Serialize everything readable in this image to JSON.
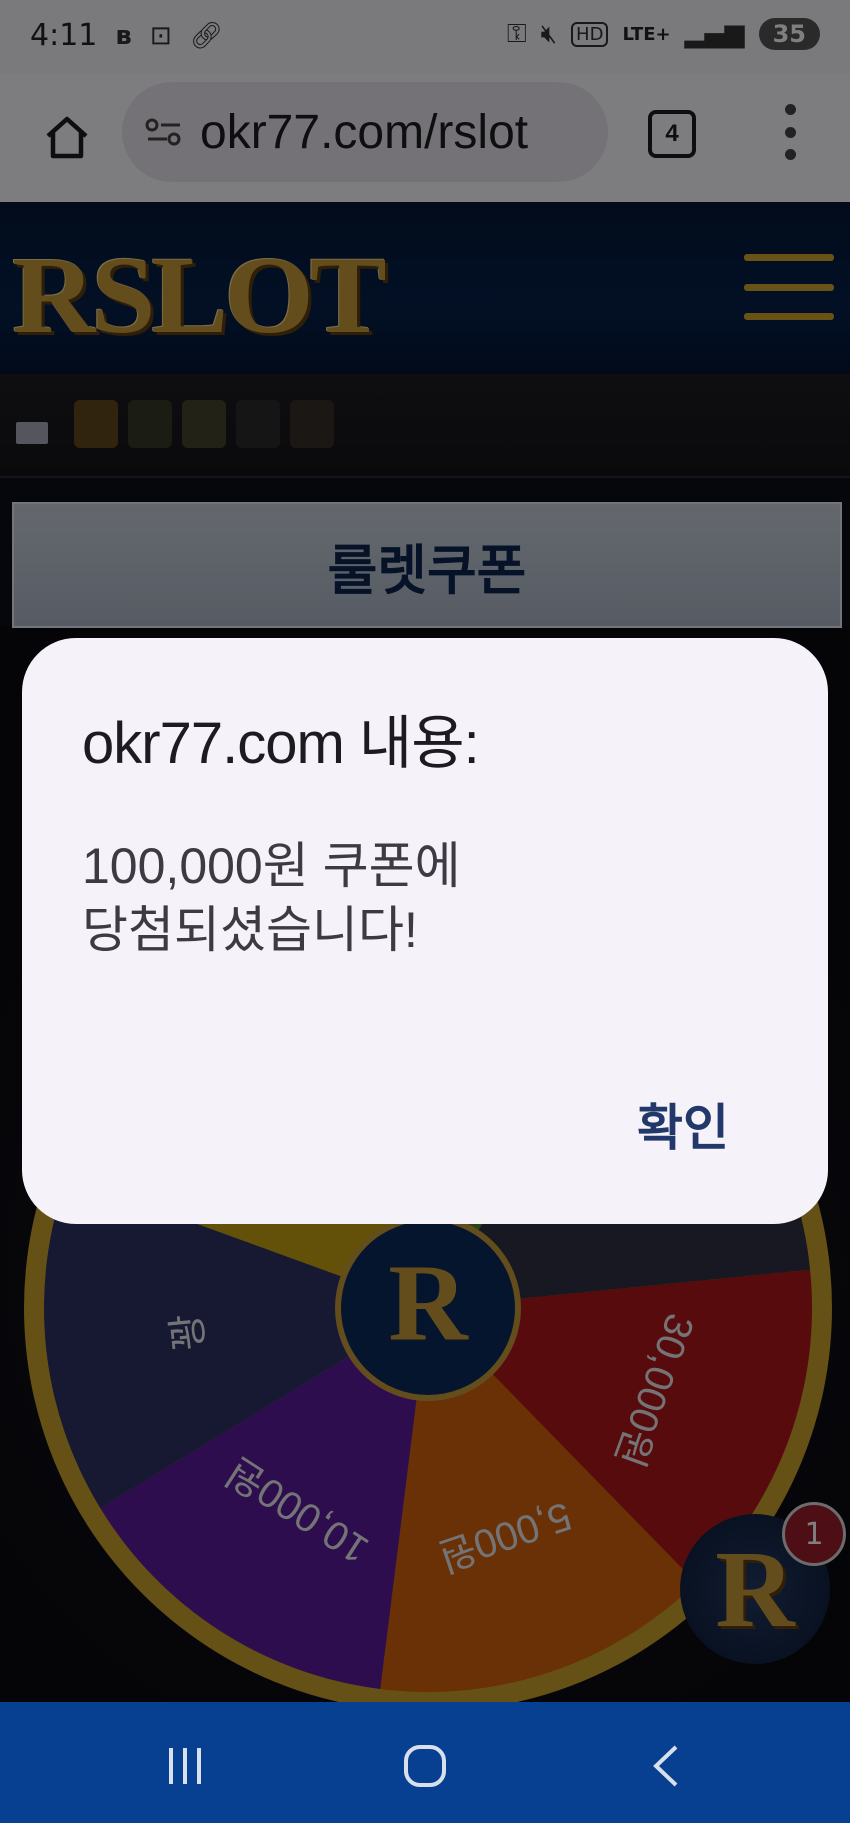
{
  "status_bar": {
    "time": "4:11",
    "notification_icons": [
      "b-app-icon",
      "screen-capture-icon",
      "link-icon"
    ],
    "system_icons": [
      "key-icon",
      "mute-icon",
      "hd-icon"
    ],
    "network": "LTE+",
    "battery": "35"
  },
  "browser": {
    "url": "okr77.com/rslot",
    "tab_count": "4"
  },
  "site": {
    "logo_text": "RSLOT",
    "banner_title": "룰렛쿠폰",
    "wheel_segments": [
      "원",
      "000원",
      "꽝",
      "30,000원",
      "5,000원",
      "10,000원",
      "꽝"
    ],
    "wheel_center": "R",
    "floating_badge_letter": "R",
    "floating_badge_count": "1"
  },
  "dialog": {
    "title": "okr77.com 내용:",
    "message_line1": "100,000원 쿠폰에",
    "message_line2": "당첨되셨습니다!",
    "ok_label": "확인"
  },
  "colors": {
    "header_navy": "#041837",
    "gold": "#c89a3a",
    "nav_bar_blue": "#074090",
    "dialog_bg": "#f6f2f9",
    "dialog_button": "#23386a"
  }
}
